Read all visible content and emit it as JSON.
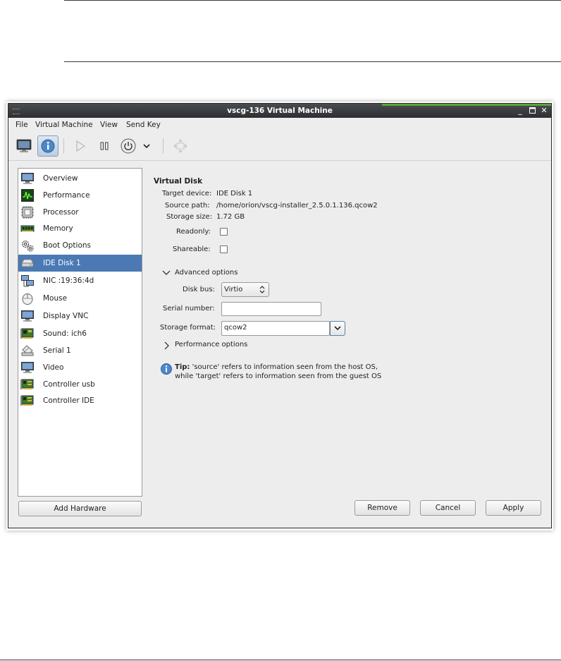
{
  "window": {
    "title": "vscg-136 Virtual Machine"
  },
  "menubar": [
    "File",
    "Virtual Machine",
    "View",
    "Send Key"
  ],
  "toolbar": {
    "buttons": [
      "monitor-icon",
      "info-icon",
      "play-icon",
      "pause-icon",
      "power-icon",
      "chevron-down-icon",
      "move-icon"
    ],
    "active": "info-icon"
  },
  "sidebar": {
    "selected": "IDE Disk 1",
    "items": [
      {
        "label": "Overview",
        "icon": "monitor-icon"
      },
      {
        "label": "Performance",
        "icon": "performance-icon"
      },
      {
        "label": "Processor",
        "icon": "cpu-icon"
      },
      {
        "label": "Memory",
        "icon": "memory-icon"
      },
      {
        "label": "Boot Options",
        "icon": "gears-icon"
      },
      {
        "label": "IDE Disk 1",
        "icon": "disk-icon"
      },
      {
        "label": "NIC :19:36:4d",
        "icon": "network-icon"
      },
      {
        "label": "Mouse",
        "icon": "mouse-icon"
      },
      {
        "label": "Display VNC",
        "icon": "display-icon"
      },
      {
        "label": "Sound: ich6",
        "icon": "sound-card-icon"
      },
      {
        "label": "Serial 1",
        "icon": "serial-icon"
      },
      {
        "label": "Video",
        "icon": "video-icon"
      },
      {
        "label": "Controller usb",
        "icon": "controller-icon"
      },
      {
        "label": "Controller IDE",
        "icon": "controller-icon"
      }
    ],
    "add_hardware": "Add Hardware"
  },
  "details": {
    "section_title": "Virtual Disk",
    "target_device_label": "Target device:",
    "target_device_value": "IDE Disk 1",
    "source_path_label": "Source path:",
    "source_path_value": "/home/orion/vscg-installer_2.5.0.1.136.qcow2",
    "storage_size_label": "Storage size:",
    "storage_size_value": "1.72 GB",
    "readonly_label": "Readonly:",
    "readonly_checked": false,
    "shareable_label": "Shareable:",
    "shareable_checked": false,
    "advanced_options": "Advanced options",
    "disk_bus_label": "Disk bus:",
    "disk_bus_value": "Virtio",
    "serial_number_label": "Serial number:",
    "serial_number_value": "",
    "storage_format_label": "Storage format:",
    "storage_format_value": "qcow2",
    "performance_options": "Performance options",
    "tip_bold": "Tip:",
    "tip_line1": " 'source' refers to information seen from the host OS,",
    "tip_line2": "while 'target' refers to information seen from the guest OS"
  },
  "actions": {
    "remove": "Remove",
    "cancel": "Cancel",
    "apply": "Apply"
  },
  "colors": {
    "selection": "#4a79b4",
    "titlebar": "#2d2f31",
    "accent_green": "#5aa53c"
  }
}
